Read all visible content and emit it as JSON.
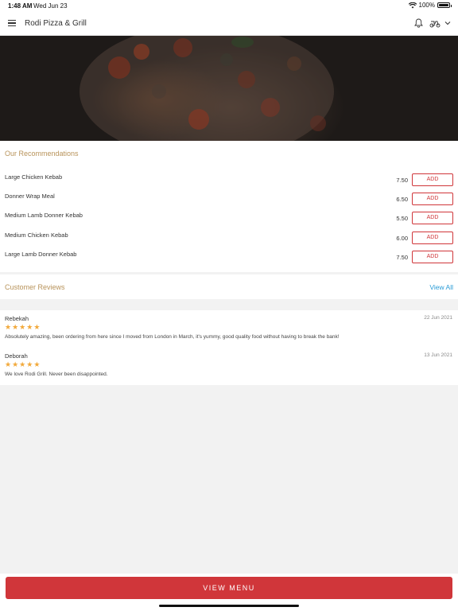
{
  "status_bar": {
    "time": "1:48 AM",
    "date": "Wed Jun 23",
    "battery": "100%"
  },
  "nav": {
    "title": "Rodi Pizza & Grill"
  },
  "recommendations": {
    "title": "Our Recommendations",
    "items": [
      {
        "name": "Large Chicken Kebab",
        "price": "7.50",
        "button": "ADD"
      },
      {
        "name": "Donner Wrap Meal",
        "price": "6.50",
        "button": "ADD"
      },
      {
        "name": "Medium Lamb Donner Kebab",
        "price": "5.50",
        "button": "ADD"
      },
      {
        "name": "Medium Chicken Kebab",
        "price": "6.00",
        "button": "ADD"
      },
      {
        "name": "Large Lamb Donner Kebab",
        "price": "7.50",
        "button": "ADD"
      }
    ]
  },
  "reviews": {
    "title": "Customer Reviews",
    "view_all": "View All",
    "items": [
      {
        "author": "Rebekah",
        "date": "22 Jun 2021",
        "stars": "★★★★★",
        "rating": 5,
        "text": "Absolutely amazing, been ordering from here since I moved from London in March, it's yummy, good quality food without having to break the bank!"
      },
      {
        "author": "Deborah",
        "date": "13 Jun 2021",
        "stars": "★★★★★",
        "rating": 5,
        "text": "We love Rodi Grill. Never been disappointed."
      }
    ]
  },
  "bottom": {
    "view_menu": "VIEW MENU"
  },
  "colors": {
    "accent_red": "#d0363a",
    "section_gold": "#b8935a",
    "link_blue": "#2a9bd6",
    "star_orange": "#f2a93b"
  }
}
